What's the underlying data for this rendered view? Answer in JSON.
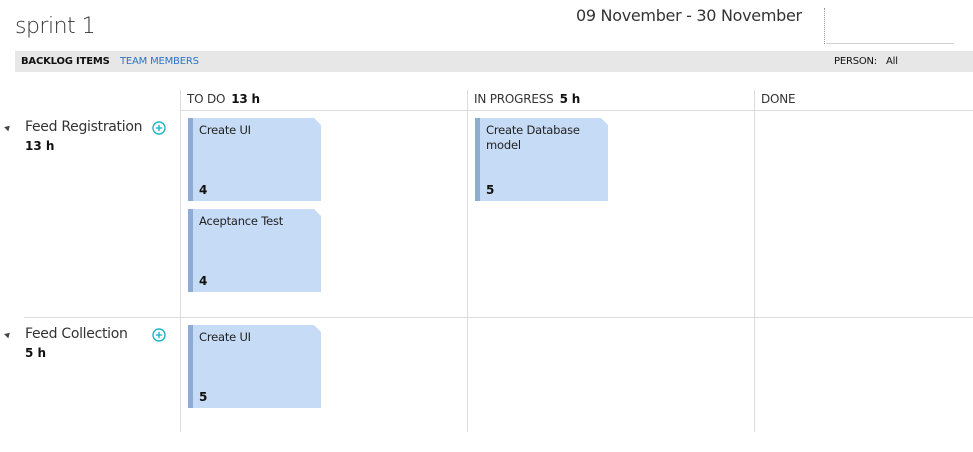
{
  "header": {
    "title": "sprint 1",
    "dates": "09 November - 30 November"
  },
  "toolbar": {
    "backlog_items": "BACKLOG ITEMS",
    "team_members": "TEAM MEMBERS",
    "person_label": "PERSON:",
    "person_value": "All"
  },
  "columns": [
    {
      "label": "TO DO",
      "hours": "13 h"
    },
    {
      "label": "IN PROGRESS",
      "hours": "5 h"
    },
    {
      "label": "DONE",
      "hours": ""
    }
  ],
  "stories": [
    {
      "name": "Feed Registration",
      "hours": "13 h",
      "todo": [
        {
          "title": "Create UI",
          "effort": "4"
        },
        {
          "title": "Aceptance Test",
          "effort": "4"
        }
      ],
      "in_progress": [
        {
          "title": "Create Database model",
          "effort": "5"
        }
      ]
    },
    {
      "name": "Feed Collection",
      "hours": "5 h",
      "todo": [
        {
          "title": "Create UI",
          "effort": "5"
        }
      ],
      "in_progress": []
    }
  ],
  "colors": {
    "card_bg": "#c6dbf6",
    "card_stripe": "#8eacd3",
    "link": "#2a74c8",
    "add_icon": "#1fb5c7"
  }
}
